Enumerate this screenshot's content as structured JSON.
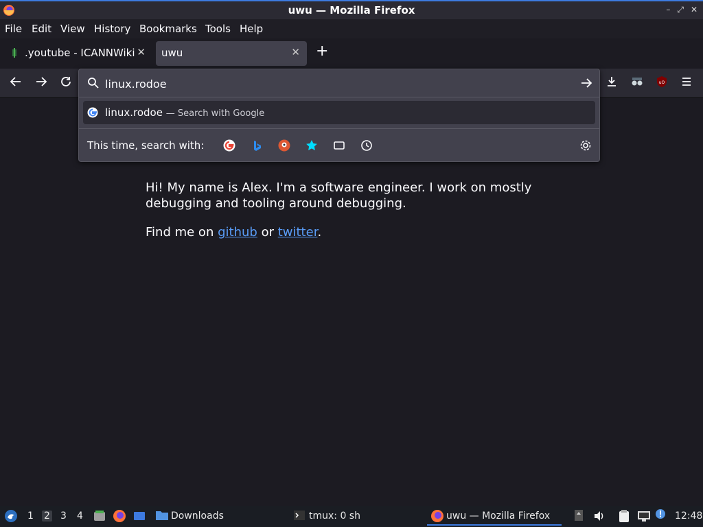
{
  "window": {
    "title": "uwu — Mozilla Firefox"
  },
  "menu": {
    "file": "File",
    "edit": "Edit",
    "view": "View",
    "history": "History",
    "bookmarks": "Bookmarks",
    "tools": "Tools",
    "help": "Help"
  },
  "tabs": [
    {
      "label": ".youtube - ICANNWiki",
      "active": false
    },
    {
      "label": "uwu",
      "active": true
    }
  ],
  "urlbar": {
    "value": "linux.rodoe",
    "suggestion_text": "linux.rodoe",
    "suggestion_desc": "Search with Google",
    "oneoff_label": "This time, search with:",
    "engines": [
      "google-icon",
      "bing-icon",
      "duckduckgo-icon",
      "bookmarks-icon",
      "tabs-icon",
      "history-icon"
    ]
  },
  "page": {
    "intro": "Hi! My name is Alex. I'm a software engineer. I work on mostly debugging and tooling around debugging.",
    "find_prefix": "Find me on",
    "github": "github",
    "or": "or",
    "twitter": "twitter",
    "period": "."
  },
  "taskbar": {
    "workspaces": [
      "1",
      "2",
      "3",
      "4"
    ],
    "active_workspace": "2",
    "downloads": "Downloads",
    "tmux": "tmux: 0 sh",
    "firefox_task": "uwu — Mozilla Firefox",
    "clock": "12:48"
  },
  "colors": {
    "accent": "#3d7ae0",
    "link": "#5a9df8",
    "background": "#1c1b22"
  }
}
